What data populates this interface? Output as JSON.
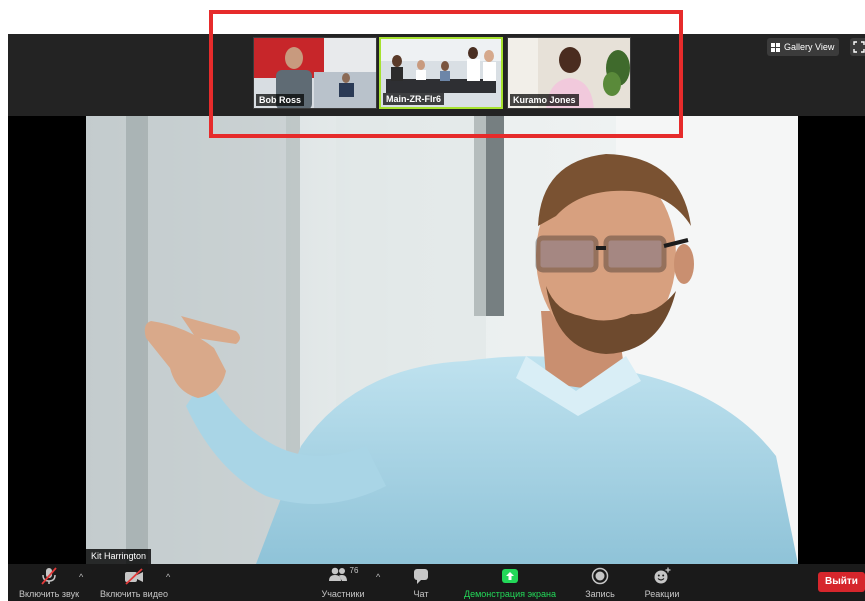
{
  "thumbnails": [
    {
      "name": "Bob Ross"
    },
    {
      "name": "Main-ZR-Flr6"
    },
    {
      "name": "Kuramo Jones"
    }
  ],
  "gallery_view_label": "Gallery View",
  "speaker_name": "Kit Harrington",
  "toolbar": {
    "unmute_label": "Включить звук",
    "start_video_label": "Включить видео",
    "participants_label": "Участники",
    "participants_count": "76",
    "chat_label": "Чат",
    "share_screen_label": "Демонстрация экрана",
    "record_label": "Запись",
    "reactions_label": "Реакции",
    "leave_label": "Выйти"
  },
  "colors": {
    "highlight": "#e62b2b",
    "share_screen": "#23d959",
    "leave": "#d6262c",
    "active_thumb_border": "#a6e22e"
  }
}
